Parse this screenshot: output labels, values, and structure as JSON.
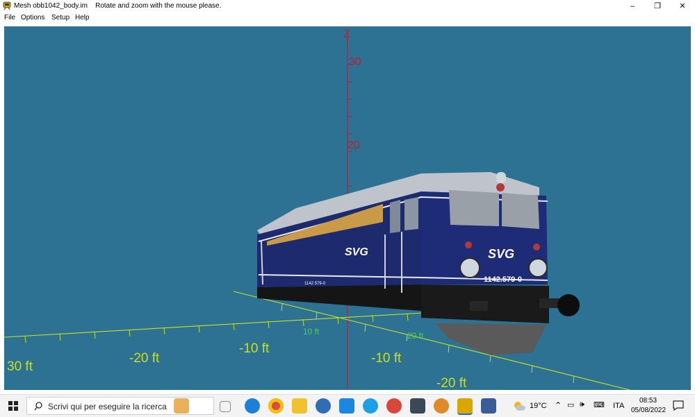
{
  "window": {
    "title": "Mesh obb1042_body.im",
    "hint": "Rotate and zoom with the mouse please.",
    "minimize": "–",
    "restore": "❐",
    "close": "✕"
  },
  "menu": {
    "file": "File",
    "options": "Options",
    "setup": "Setup",
    "help": "Help"
  },
  "viewport": {
    "background": "#2d7193",
    "axis_z_label": "Z",
    "z_ticks": [
      "30",
      "20"
    ],
    "ft_labels_left": [
      "30 ft",
      "-20 ft",
      "-10 ft"
    ],
    "ft_labels_right": [
      "-10 ft",
      "-20 ft"
    ],
    "ft_small_labels": [
      "10 ft",
      "20 ft"
    ],
    "model": {
      "logo": "SVG",
      "number_front": "1142.579-0",
      "number_side": "1142 579-0",
      "body_color": "#1e2a6e"
    }
  },
  "taskbar": {
    "search_placeholder": "Scrivi qui per eseguire la ricerca",
    "weather": "19°C",
    "language": "ITA",
    "time": "08:53",
    "date": "05/08/2022"
  }
}
